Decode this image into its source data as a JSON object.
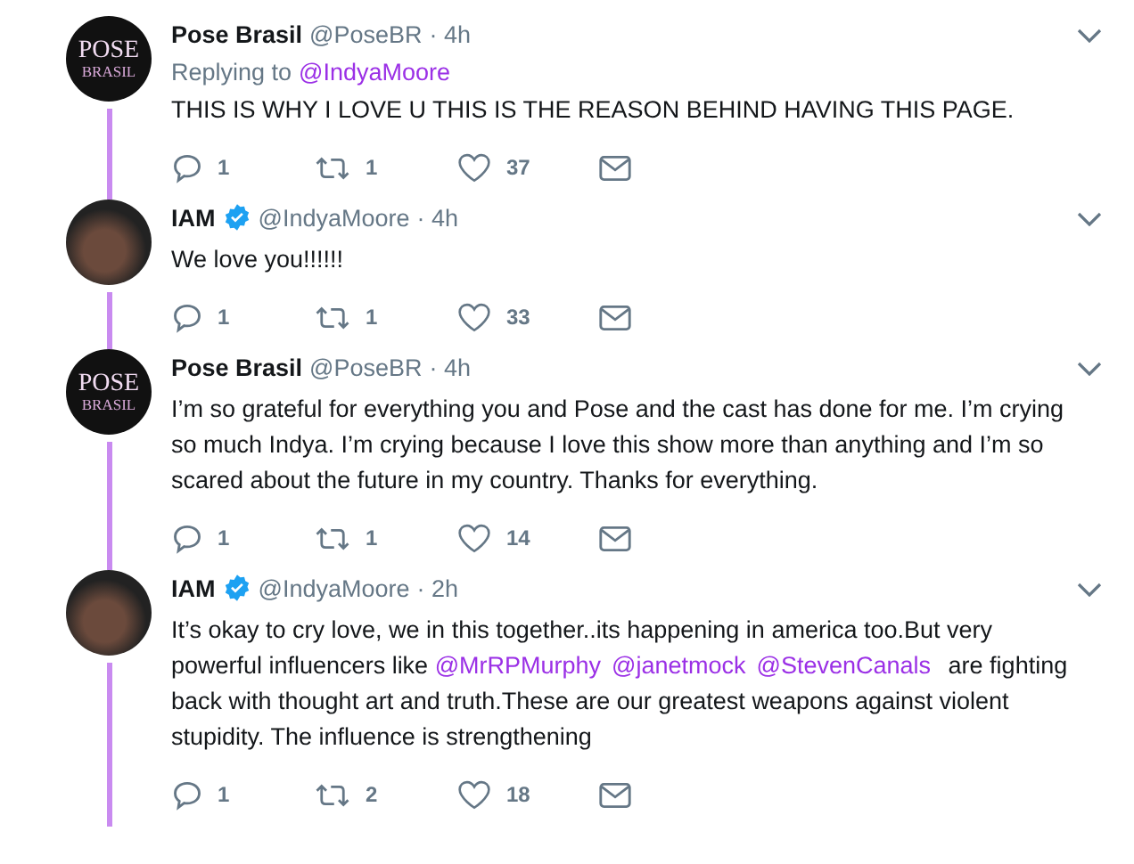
{
  "tweets": [
    {
      "avatar": {
        "kind": "logo",
        "line1": "POSE",
        "line2": "BRASIL"
      },
      "name": "Pose Brasil",
      "verified": false,
      "handle": "@PoseBR",
      "time": "· 4h",
      "replying_to": {
        "label": "Replying to",
        "mention": "@IndyaMoore"
      },
      "text": [
        {
          "kind": "text",
          "s": "THIS IS WHY I LOVE U THIS IS THE REASON BEHIND HAVING THIS PAGE."
        }
      ],
      "replies": "1",
      "retweets": "1",
      "likes": "37"
    },
    {
      "avatar": {
        "kind": "photo"
      },
      "name": "IAM",
      "verified": true,
      "handle": "@IndyaMoore",
      "time": "· 4h",
      "text": [
        {
          "kind": "text",
          "s": "We love you!!!!!!"
        }
      ],
      "replies": "1",
      "retweets": "1",
      "likes": "33"
    },
    {
      "avatar": {
        "kind": "logo",
        "line1": "POSE",
        "line2": "BRASIL"
      },
      "name": "Pose Brasil",
      "verified": false,
      "handle": "@PoseBR",
      "time": "· 4h",
      "text": [
        {
          "kind": "text",
          "s": "I’m so grateful for everything you and Pose and the cast has done for me. I’m crying so much Indya. I’m crying because I love this show more than anything and I’m so scared about the future in my country. Thanks for everything."
        }
      ],
      "replies": "1",
      "retweets": "1",
      "likes": "14"
    },
    {
      "avatar": {
        "kind": "photo"
      },
      "name": "IAM",
      "verified": true,
      "handle": "@IndyaMoore",
      "time": "· 2h",
      "text": [
        {
          "kind": "text",
          "s": "It’s okay to cry love, we in this together..its happening in america too.But very powerful influencers like "
        },
        {
          "kind": "mention",
          "s": "@MrRPMurphy"
        },
        {
          "kind": "mention",
          "s": "@janetmock"
        },
        {
          "kind": "mention",
          "s": "@StevenCanals"
        },
        {
          "kind": "text",
          "s": " are fighting back with thought art and truth.These are our greatest weapons against violent stupidity. The influence is strengthening"
        }
      ],
      "replies": "1",
      "retweets": "2",
      "likes": "18"
    }
  ]
}
